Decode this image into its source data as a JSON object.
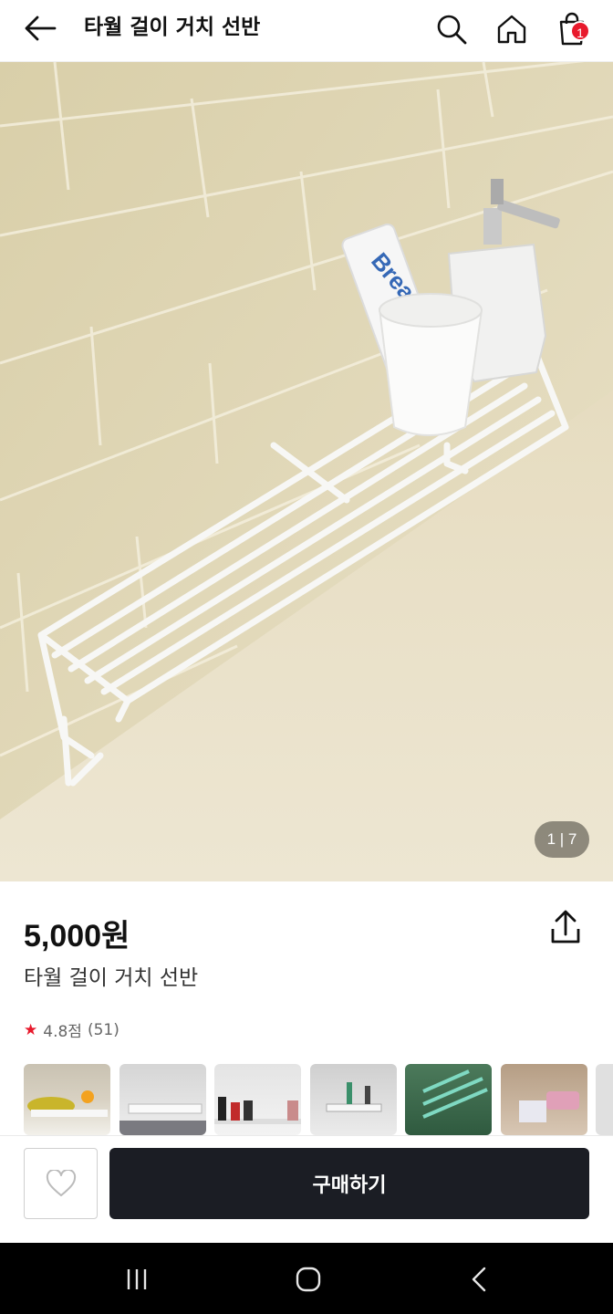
{
  "header": {
    "title": "타월 걸이 거치 선반",
    "cart_count": "1"
  },
  "hero": {
    "image_counter": "1 | 7",
    "toothpaste_text": "Breathing"
  },
  "product": {
    "price": "5,000원",
    "name": "타월 걸이 거치 선반",
    "rating": "4.8점",
    "review_count": "(51)"
  },
  "actions": {
    "buy_label": "구매하기"
  },
  "colors": {
    "accent": "#e8192c",
    "buy_button": "#1b1d24"
  }
}
